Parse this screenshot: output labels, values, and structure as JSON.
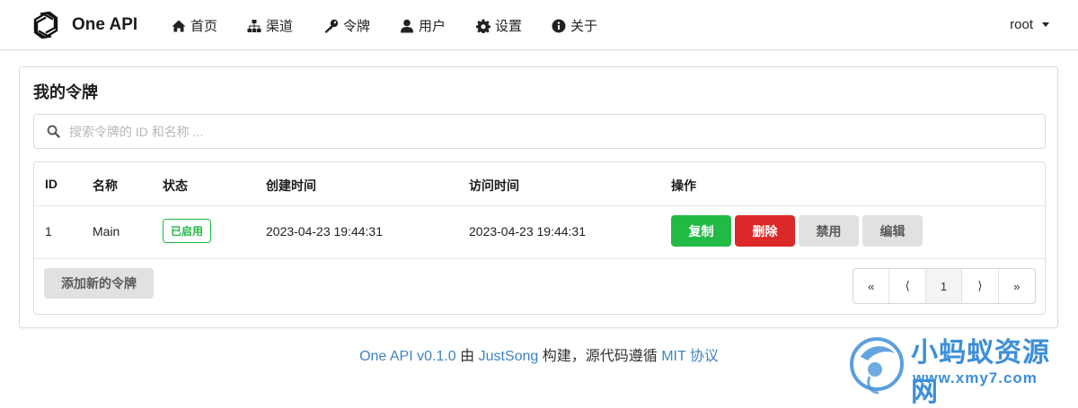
{
  "app": {
    "name": "One API"
  },
  "nav": {
    "items": [
      {
        "label": "首页",
        "icon": "home-icon"
      },
      {
        "label": "渠道",
        "icon": "sitemap-icon"
      },
      {
        "label": "令牌",
        "icon": "key-icon"
      },
      {
        "label": "用户",
        "icon": "user-icon"
      },
      {
        "label": "设置",
        "icon": "gear-icon"
      },
      {
        "label": "关于",
        "icon": "info-icon"
      }
    ],
    "user": "root"
  },
  "page": {
    "title": "我的令牌"
  },
  "search": {
    "placeholder": "搜索令牌的 ID 和名称 ..."
  },
  "table": {
    "headers": [
      "ID",
      "名称",
      "状态",
      "创建时间",
      "访问时间",
      "操作"
    ],
    "rows": [
      {
        "id": "1",
        "name": "Main",
        "status": "已启用",
        "created": "2023-04-23 19:44:31",
        "accessed": "2023-04-23 19:44:31",
        "actions": [
          "复制",
          "删除",
          "禁用",
          "编辑"
        ]
      }
    ]
  },
  "add_button": "添加新的令牌",
  "pagination": {
    "first": "«",
    "prev": "⟨",
    "current": "1",
    "next": "⟩",
    "last": "»"
  },
  "footer": {
    "version_link": "One API v0.1.0",
    "by": " 由 ",
    "author_link": "JustSong",
    "middle": " 构建，源代码遵循 ",
    "license_link": "MIT 协议"
  },
  "watermark": {
    "title": "小蚂蚁资源网",
    "url": "www.xmy7.com"
  },
  "colors": {
    "green": "#21ba45",
    "red": "#db2828",
    "link": "#4183c4",
    "watermark": "#3d8fd8"
  }
}
